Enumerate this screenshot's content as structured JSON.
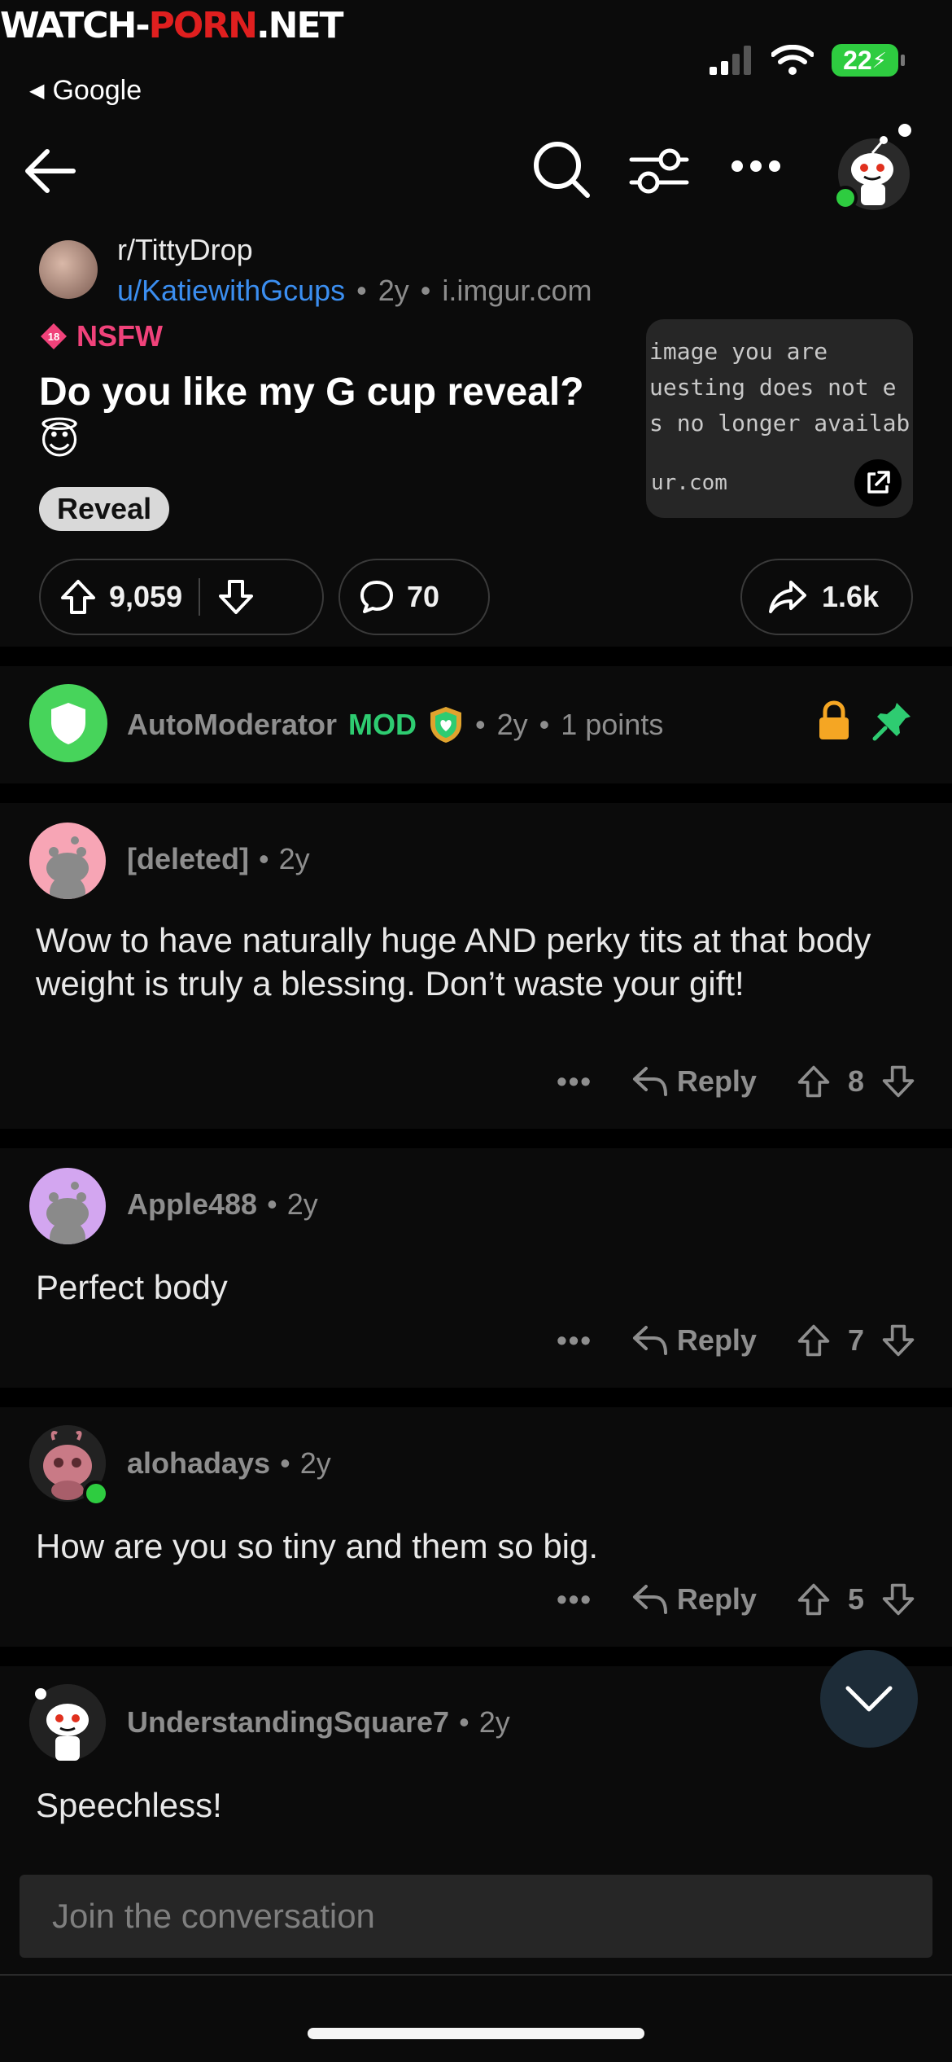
{
  "status": {
    "watermark_a": "WATCH-",
    "watermark_b": "PORN",
    "watermark_c": ".NET",
    "back_app": "Google",
    "battery": "22"
  },
  "post": {
    "subreddit": "r/TittyDrop",
    "author": "u/KatiewithGcups",
    "age": "2y",
    "domain": "i.imgur.com",
    "nsfw_label": "NSFW",
    "title": "Do you like my G cup reveal?",
    "title_emoji": "😇",
    "flair": "Reveal",
    "thumb_text": "image you are\nuesting does not e\ns no longer availab",
    "thumb_domain": "ur.com",
    "score": "9,059",
    "comments": "70",
    "shares": "1.6k"
  },
  "automod": {
    "name": "AutoModerator",
    "mod_label": "MOD",
    "age": "2y",
    "points": "1 points"
  },
  "comments": [
    {
      "author": "[deleted]",
      "age": "2y",
      "body": "Wow to have naturally huge AND perky tits at that body weight is truly a blessing. Don’t waste your gift!",
      "reply": "Reply",
      "score": "8"
    },
    {
      "author": "Apple488",
      "age": "2y",
      "body": "Perfect body",
      "reply": "Reply",
      "score": "7"
    },
    {
      "author": "alohadays",
      "age": "2y",
      "body": "How are you so tiny and them so big.",
      "reply": "Reply",
      "score": "5"
    },
    {
      "author": "UnderstandingSquare7",
      "age": "2y",
      "body": "Speechless!"
    }
  ],
  "composer": {
    "placeholder": "Join the conversation"
  },
  "colors": {
    "accent_blue": "#3b8ef0",
    "nsfw": "#f0427a",
    "mod_green": "#2ecc71",
    "lock": "#f5a623"
  },
  "icons": [
    "back-arrow-icon",
    "search-icon",
    "filter-icon",
    "more-icon",
    "reddit-avatar-icon",
    "upvote-icon",
    "downvote-icon",
    "comment-icon",
    "share-icon",
    "lock-icon",
    "pin-icon",
    "reply-icon",
    "chevron-down-icon",
    "external-link-icon"
  ]
}
